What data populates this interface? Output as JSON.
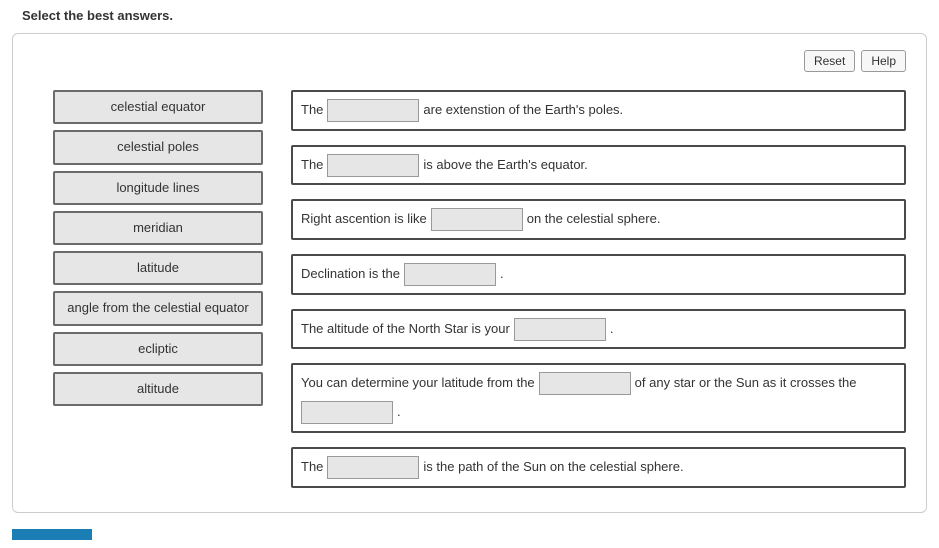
{
  "pageTitle": "Select the best answers.",
  "buttons": {
    "reset": "Reset",
    "help": "Help"
  },
  "terms": [
    "celestial equator",
    "celestial poles",
    "longitude lines",
    "meridian",
    "latitude",
    "angle from the celestial equator",
    "ecliptic",
    "altitude"
  ],
  "sentences": {
    "s1": {
      "p1": "The",
      "p2": "are extenstion of the Earth's poles."
    },
    "s2": {
      "p1": "The",
      "p2": "is above the Earth's equator."
    },
    "s3": {
      "p1": "Right ascention is like",
      "p2": "on the celestial sphere."
    },
    "s4": {
      "p1": "Declination is the",
      "p2": "."
    },
    "s5": {
      "p1": "The altitude of the North Star is your",
      "p2": "."
    },
    "s6": {
      "p1": "You can determine your latitude from the",
      "p2": "of any star or the Sun as it crosses the",
      "p3": "."
    },
    "s7": {
      "p1": "The",
      "p2": "is the path of the Sun on the celestial sphere."
    }
  }
}
